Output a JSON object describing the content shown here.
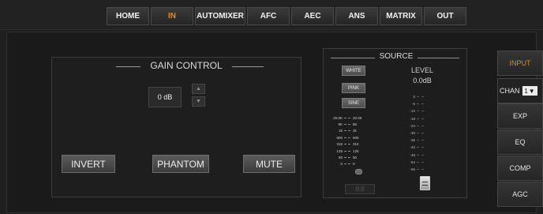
{
  "nav": {
    "tabs": [
      {
        "label": "HOME",
        "active": false
      },
      {
        "label": "IN",
        "active": true
      },
      {
        "label": "AUTOMIXER",
        "active": false
      },
      {
        "label": "AFC",
        "active": false
      },
      {
        "label": "AEC",
        "active": false
      },
      {
        "label": "ANS",
        "active": false
      },
      {
        "label": "MATRIX",
        "active": false
      },
      {
        "label": "OUT",
        "active": false
      }
    ]
  },
  "gain": {
    "title": "GAIN CONTROL",
    "value": "0 dB",
    "up_glyph": "▲",
    "down_glyph": "▼",
    "buttons": {
      "invert": "INVERT",
      "phantom": "PHANTOM",
      "mute": "MUTE"
    }
  },
  "source": {
    "title": "SOURCE",
    "buttons": {
      "white": "WHITE",
      "pink": "PINK",
      "sine": "SINE"
    },
    "freq_scale": [
      {
        "left": "20.0K",
        "right": "20.0K"
      },
      {
        "left": "8K",
        "right": "8K"
      },
      {
        "left": "2k",
        "right": "2k"
      },
      {
        "left": "600",
        "right": "600"
      },
      {
        "left": "315",
        "right": "315"
      },
      {
        "left": "125",
        "right": "125"
      },
      {
        "left": "50",
        "right": "50"
      },
      {
        "left": "0",
        "right": "0"
      }
    ],
    "freq_readout": "0.0",
    "level": {
      "label": "LEVEL",
      "value": "0.0dB",
      "scale": [
        "0",
        "-6",
        "-12",
        "-18",
        "-24",
        "-30",
        "-36",
        "-42",
        "-48",
        "-54",
        "-60"
      ]
    }
  },
  "side": {
    "input_label": "INPUT",
    "chan_label": "CHAN",
    "chan_value": "1",
    "chan_arrow": "▼",
    "exp_label": "EXP",
    "eq_label": "EQ",
    "comp_label": "COMP",
    "agc_label": "AGC"
  },
  "colors": {
    "accent": "#e08a1e",
    "background": "#1f1f1f",
    "panel_border": "#3c3c3c"
  }
}
